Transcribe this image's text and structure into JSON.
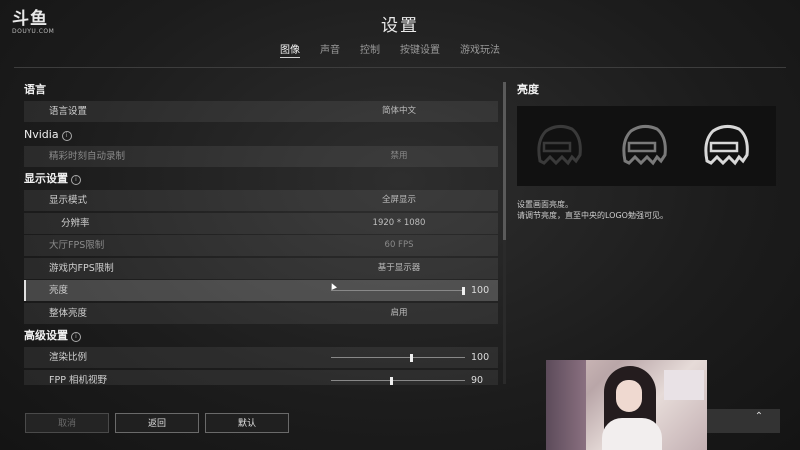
{
  "logo": {
    "mark": "斗鱼",
    "sub": "DOUYU.COM"
  },
  "title": "设置",
  "tabs": [
    "图像",
    "声音",
    "控制",
    "按键设置",
    "游戏玩法"
  ],
  "sections": {
    "language": "语言",
    "nvidia": "Nvidia",
    "display": "显示设置",
    "advanced": "高级设置"
  },
  "rows": {
    "language_setting": {
      "label": "语言设置",
      "value": "简体中文"
    },
    "highlights": {
      "label": "精彩时刻自动录制",
      "value": "禁用"
    },
    "display_mode": {
      "label": "显示模式",
      "value": "全屏显示"
    },
    "resolution": {
      "label": "分辨率",
      "value": "1920 * 1080"
    },
    "lobby_fps": {
      "label": "大厅FPS限制",
      "value": "60 FPS"
    },
    "ingame_fps": {
      "label": "游戏内FPS限制",
      "value": "基于显示器"
    },
    "brightness": {
      "label": "亮度",
      "value": "100",
      "level": 1.0
    },
    "overall_brightness": {
      "label": "整体亮度",
      "value": "启用"
    },
    "render_scale": {
      "label": "渲染比例",
      "value": "100",
      "level": 0.6
    },
    "fpp_fov": {
      "label": "FPP 相机视野",
      "value": "90",
      "level": 0.45
    }
  },
  "right_panel": {
    "title": "亮度",
    "desc_line1": "设置画面亮度。",
    "desc_line2": "请调节亮度，直至中央的LOGO勉强可见。",
    "helmet_colors": [
      "#3a3a3a",
      "#7a7a7a",
      "#d8d8d8"
    ]
  },
  "buttons": {
    "cancel": "取消",
    "back": "返回",
    "default": "默认"
  },
  "bottom": {
    "chevron_icon": "chevron-up-icon"
  }
}
